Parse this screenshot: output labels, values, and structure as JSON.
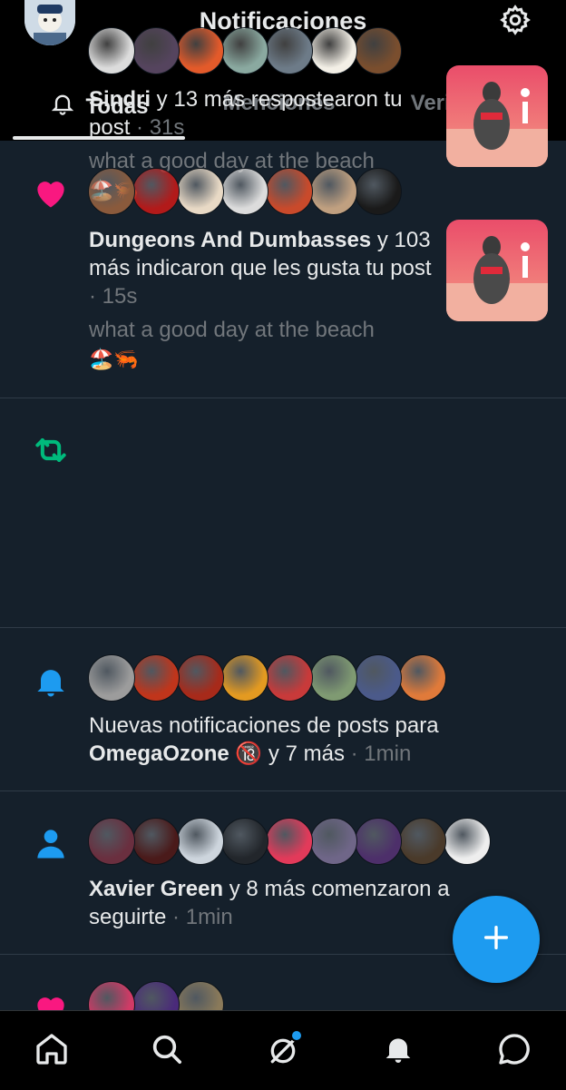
{
  "header": {
    "title": "Notificaciones"
  },
  "tabs": [
    {
      "label": "Todas"
    },
    {
      "label": "Menciones"
    },
    {
      "label": "Verificado"
    }
  ],
  "notifications": [
    {
      "type": "like",
      "actor": "Dungeons And Dumbasses",
      "rest": " y 103 más indicaron que les gusta tu post",
      "time": " · 15s",
      "post": "what a good day at the beach",
      "emoji": "🏖️🦐",
      "colors": [
        "#8a5a3c",
        "#b21a1a",
        "#e8d9c5",
        "#dcdcdc",
        "#c94a2b",
        "#c0a080",
        "#1a1a1a"
      ]
    },
    {
      "type": "repost",
      "actor": "Sindri",
      "rest": " y 13 más respostearon tu post",
      "time": " · 31s",
      "post": "what a good day at the beach",
      "emoji": "🏖️🦐",
      "colors": [
        "#dcdcdc",
        "#55445e",
        "#e35a2a",
        "#8aa9a0",
        "#6d7b88",
        "#f3efe6",
        "#7a4e2e"
      ]
    },
    {
      "type": "subscription",
      "line1": "Nuevas notificaciones de posts para",
      "actor": "OmegaOzone",
      "badge": "🔞",
      "rest": " y 7 más",
      "time": " · 1min",
      "colors": [
        "#9c9c9c",
        "#c0351b",
        "#a72a1a",
        "#e39a21",
        "#c83a3a",
        "#7f9a72",
        "#4b5a8a",
        "#e07a3a"
      ]
    },
    {
      "type": "follow",
      "actor": "Xavier Green",
      "rest": " y 8 más comenzaron a seguirte",
      "time": " · 1min",
      "colors": [
        "#6a2f3f",
        "#4a1a1a",
        "#cdd5dd",
        "#22262b",
        "#e23a5a",
        "#6f6688",
        "#4d2f6a",
        "#4a3a2a",
        "#eeeeee"
      ]
    },
    {
      "type": "like",
      "colors": [
        "#d23a66",
        "#4a2a7a",
        "#8a7a5a"
      ]
    }
  ],
  "colors": {
    "like": "#f91880",
    "repost": "#00ba7c",
    "accent": "#1d9bf0"
  }
}
